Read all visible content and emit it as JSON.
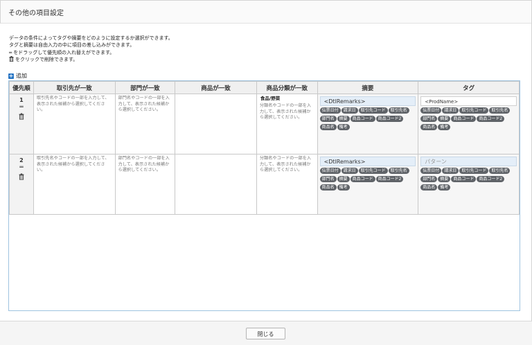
{
  "dialog": {
    "title": "その他の項目設定"
  },
  "description": {
    "line1": "データの条件によってタグや摘要をどのように設定するか選択ができます。",
    "line2": "タグと摘要は自由入力の中に項目の差し込みができます。",
    "line3_glyph": "═",
    "line3": "をドラッグして優先順の入れ替えができます。",
    "line4": "をクリックで削除できます。"
  },
  "add_label": "追加",
  "columns": {
    "priority": "優先順",
    "client": "取引先が一致",
    "department": "部門が一致",
    "product": "商品が一致",
    "category": "商品分類が一致",
    "remarks": "摘要",
    "tag": "タグ"
  },
  "rows": [
    {
      "priority": "1",
      "client_placeholder": "取引先名やコードの一部を入力して、表示された候補から選択してください。",
      "department_placeholder": "部門名やコードの一部を入力して、表示された候補から選択してください。",
      "category_value": "食品/野菜",
      "category_placeholder": "分類名やコードの一部を入力して、表示された候補から選択してください。",
      "remarks_template": "<DtlRemarks>",
      "tag_template": "<ProdName>"
    },
    {
      "priority": "2",
      "client_placeholder": "取引先名やコードの一部を入力して、表示された候補から選択してください。",
      "department_placeholder": "部門名やコードの一部を入力して、表示された候補から選択してください。",
      "category_placeholder": "分類名やコードの一部を入力して、表示された候補から選択してください。",
      "remarks_template": "<DtlRemarks>",
      "tag_placeholder": "パターン"
    }
  ],
  "chips": {
    "c1": "伝票日付",
    "c2": "請求日",
    "c3": "取引先コード",
    "c4": "取引先名",
    "c5": "部門名",
    "c6": "摘要",
    "c7": "商品コード",
    "c8": "商品コード2",
    "c9": "商品名",
    "c10": "備考"
  },
  "footer": {
    "close_label": "閉じる"
  },
  "icons": {
    "add": "plus-square-icon",
    "drag": "drag-handle-icon",
    "delete": "trash-icon"
  },
  "colors": {
    "accent": "#2b78c5",
    "chip": "#5f6368",
    "template_bg": "#e4eef8",
    "grid_border": "#9fc3e0"
  }
}
